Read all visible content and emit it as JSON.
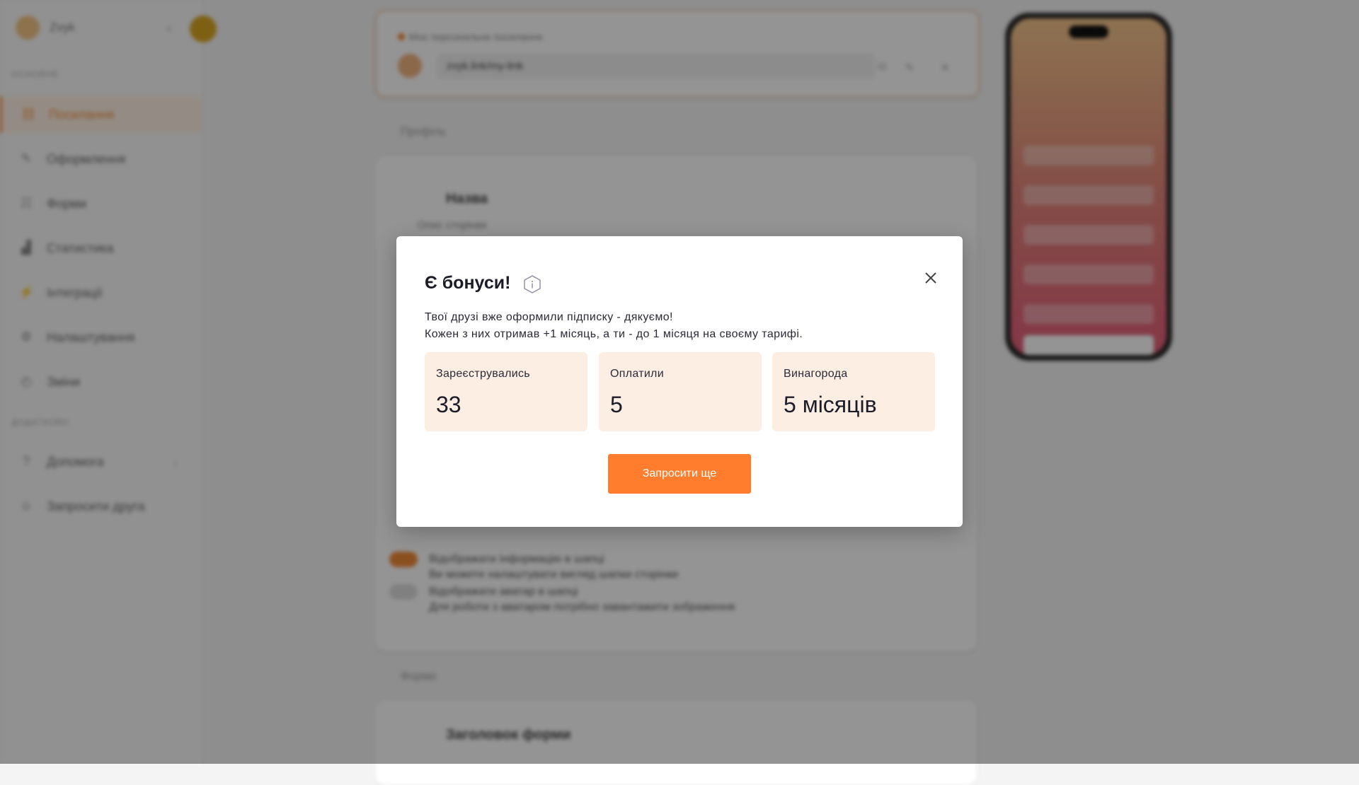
{
  "sidebar": {
    "brand_name": "Zvyk",
    "section_main": "ОСНОВНЕ",
    "section_extra": "ДОДАТКОВО",
    "items": [
      {
        "label": "Посилання",
        "icon": "link-icon",
        "active": true
      },
      {
        "label": "Оформлення",
        "icon": "brush-icon"
      },
      {
        "label": "Форми",
        "icon": "form-icon"
      },
      {
        "label": "Статистика",
        "icon": "chart-icon"
      },
      {
        "label": "Інтеграції",
        "icon": "plug-icon"
      },
      {
        "label": "Налаштування",
        "icon": "gear-icon"
      },
      {
        "label": "Зміни",
        "icon": "history-icon"
      }
    ],
    "extra_items": [
      {
        "label": "Допомога",
        "icon": "help-icon"
      },
      {
        "label": "Запросити друга",
        "icon": "invite-icon"
      }
    ]
  },
  "main": {
    "link_label": "Моє персональне посилання",
    "link_value": "zvyk.link/my-link",
    "section_profile": "Профіль",
    "profile_title": "Назва",
    "profile_subtitle": "Опис сторінки",
    "toggle_1_title": "Відображати інформацію в шапці",
    "toggle_1_desc": "Ви можете налаштувати вигляд шапки сторінки",
    "toggle_2_title": "Відображати аватар в шапці",
    "toggle_2_desc": "Для роботи з аватаром потрібно завантажити зображення",
    "section_forms": "Форми",
    "forms_title": "Заголовок форми"
  },
  "modal": {
    "title": "Є бонуси!",
    "line1": "Твої друзі вже оформили підписку - дякуємо!",
    "line2": "Кожен з них отримав +1 місяць, а ти - до 1 місяця на своєму тарифі.",
    "stats": [
      {
        "label": "Зареєструвались",
        "value": "33"
      },
      {
        "label": "Оплатили",
        "value": "5"
      },
      {
        "label": "Винагорода",
        "value": "5 місяців"
      }
    ],
    "invite_label": "Запросити ще"
  },
  "colors": {
    "accent": "#ff7d2d",
    "stat_bg": "#fdeee4",
    "overlay": "rgba(0,0,0,0.42)"
  }
}
